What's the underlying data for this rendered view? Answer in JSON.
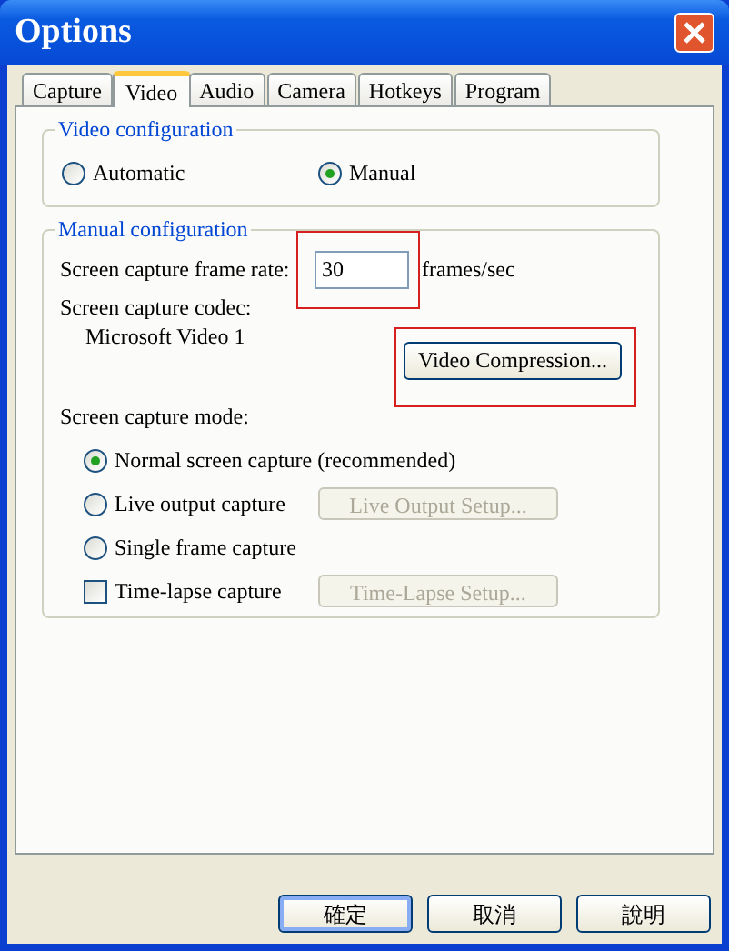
{
  "window": {
    "title": "Options"
  },
  "tabs": [
    {
      "label": "Capture",
      "selected": false
    },
    {
      "label": "Video",
      "selected": true
    },
    {
      "label": "Audio",
      "selected": false
    },
    {
      "label": "Camera",
      "selected": false
    },
    {
      "label": "Hotkeys",
      "selected": false
    },
    {
      "label": "Program",
      "selected": false
    }
  ],
  "video_configuration": {
    "title": "Video configuration",
    "options": [
      {
        "label": "Automatic",
        "selected": false
      },
      {
        "label": "Manual",
        "selected": true
      }
    ]
  },
  "manual_configuration": {
    "title": "Manual configuration",
    "frame_rate": {
      "label": "Screen capture frame rate:",
      "value": "30",
      "unit": "frames/sec",
      "highlighted": true
    },
    "codec": {
      "label": "Screen capture codec:",
      "value": "Microsoft Video 1",
      "button": {
        "label": "Video Compression...",
        "highlighted": true
      }
    },
    "capture_mode": {
      "label": "Screen capture mode:",
      "options": [
        {
          "kind": "radio",
          "label": "Normal screen capture (recommended)",
          "selected": true
        },
        {
          "kind": "radio",
          "label": "Live output capture",
          "selected": false,
          "button": {
            "label": "Live Output Setup...",
            "disabled": true
          }
        },
        {
          "kind": "radio",
          "label": "Single frame capture",
          "selected": false
        },
        {
          "kind": "checkbox",
          "label": "Time-lapse capture",
          "checked": false,
          "button": {
            "label": "Time-Lapse Setup...",
            "disabled": true
          }
        }
      ]
    }
  },
  "buttons": [
    {
      "label": "確定",
      "default": true
    },
    {
      "label": "取消",
      "default": false
    },
    {
      "label": "說明",
      "default": false
    }
  ]
}
